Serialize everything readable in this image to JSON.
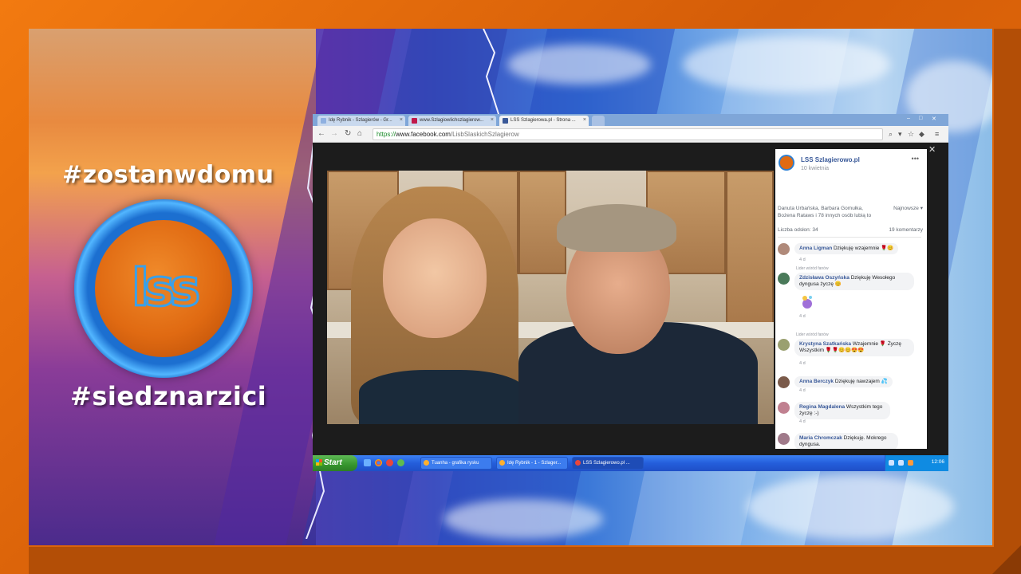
{
  "overlay": {
    "hashtag_top": "#zostanwdomu",
    "hashtag_bottom": "#siedznarzici",
    "logo_text": "lss"
  },
  "browser": {
    "tabs": [
      {
        "label": "Idę Rybnik - Szlagierów - Gr...",
        "favicon_color": "#8fb0e0"
      },
      {
        "label": "www.Szlagiowlichszlagierow...",
        "favicon_color": "#c0184a"
      },
      {
        "label": "LSS Szlagierowa.pl - Strona ...",
        "favicon_color": "#3b5998"
      }
    ],
    "url_scheme": "https://",
    "url_domain": "www.facebook.com",
    "url_path": "/LisbSlaskichSzlagierow"
  },
  "facebook": {
    "page_name": "LSS Szlagierowo.pl",
    "post_time": "10 kwietnia",
    "reactions_text": "Danuta Urbańska, Barbara Gomułka, Bożena Rataws i 78 innych osób lubią to",
    "sort_label": "Najnowsze ▾",
    "views_label": "Liczba odsłon: 34",
    "comments_count": "19 komentarzy",
    "comments": [
      {
        "author": "Anna Ligman",
        "text": "Dziękuję wzajemnie 🌹😊",
        "time": "4 d",
        "fan_badge": "",
        "avatar_color": "#b08a7a"
      },
      {
        "author": "Zdzisława Oszyńska",
        "text": "Dziękuję Wesołego dyngusa życzę 😊",
        "time": "4 d",
        "fan_badge": "Lider wśród fanów",
        "avatar_color": "#4a7a5a"
      },
      {
        "author": "Krystyna Szatkańska",
        "text": "Wzajemnie 🌹 Życzę Wszystkim 🌹🌹😊😊😍😍",
        "time": "4 d",
        "fan_badge": "Lider wśród fanów",
        "avatar_color": "#9aa070"
      },
      {
        "author": "Anna Berczyk",
        "text": "Dziękuję nawzajem 💦",
        "time": "4 d",
        "fan_badge": "",
        "avatar_color": "#7a5a4a"
      },
      {
        "author": "Regina Magdalena",
        "text": "Wszystkim tego życzę :-)",
        "time": "4 d",
        "fan_badge": "",
        "avatar_color": "#c08090"
      },
      {
        "author": "Maria Chromczak",
        "text": "Dziękuję. Mokrego dyngusa.",
        "time": "",
        "fan_badge": "",
        "avatar_color": "#a07a8a"
      }
    ]
  },
  "taskbar": {
    "start_label": "Start",
    "tasks": [
      {
        "label": "Tuanha - grafika rysku",
        "icon_color": "#ffb02e",
        "active": false
      },
      {
        "label": "Idę Rybnik - 1 - Szlager...",
        "icon_color": "#ffb02e",
        "active": false
      },
      {
        "label": "LSS Szlagierowo.pl ...",
        "icon_color": "#e8463c",
        "active": true
      }
    ],
    "clock": "12:06"
  }
}
